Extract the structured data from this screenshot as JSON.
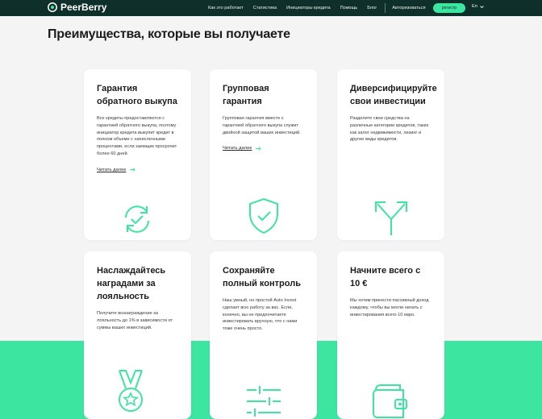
{
  "header": {
    "logo_text": "PeerBerry",
    "nav": [
      "Как это работает",
      "Статистика",
      "Инициаторы кредита",
      "Помощь",
      "Блог"
    ],
    "login_label": "Авторизоваться",
    "register_label": "регистр",
    "language": "En"
  },
  "page": {
    "headline": "Преимущества, которые вы получаете"
  },
  "colors": {
    "accent": "#3ce6a0",
    "dark": "#0f2f2a",
    "background": "#f4f4f5"
  },
  "cards": [
    {
      "title": "Гарантия обратного выкупа",
      "text": "Все кредиты предоставляются с гарантией обратного выкупа, поэтому инициатор кредита выкупит кредит в полном объеме с начисленными процентами, если заемщик просрочит более 60 дней.",
      "link": "Читать далее",
      "icon": "refresh-check-icon"
    },
    {
      "title": "Групповая гарантия",
      "text": "Групповая гарантия вместе с гарантией обратного выкупа служит двойной защитой ваших инвестиций.",
      "link": "Читать далее",
      "icon": "shield-check-icon"
    },
    {
      "title": "Диверсифицируйте свои инвестиции",
      "text": "Разделите свои средства на различные категории кредитов, таких как залог недвижимости, лизинг и другие виды кредитов.",
      "icon": "split-arrows-icon"
    },
    {
      "title": "Наслаждайтесь наградами за лояльность",
      "text": "Получите вознаграждение за лояльность до 1% в зависимости от суммы ваших инвестиций.",
      "icon": "medal-icon"
    },
    {
      "title": "Сохраняйте полный контроль",
      "text": "Наш умный, но простой Auto Invest сделает всю работу за вас. Если, конечно, вы не предпочитаете инвестировать вручную, что с нами тоже очень просто.",
      "icon": "sliders-icon"
    },
    {
      "title": "Начните всего с 10 €",
      "text": "Мы хотим принести пассивный доход каждому, чтобы вы могли начать с инвестирования всего 10 евро.",
      "icon": "wallet-icon"
    }
  ]
}
